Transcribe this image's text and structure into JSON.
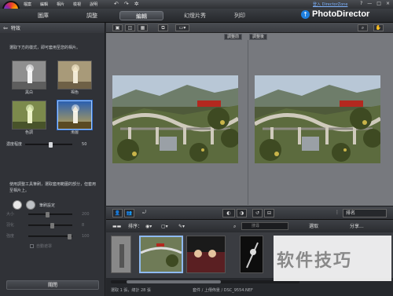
{
  "menubar": {
    "menus": [
      "檔案",
      "編輯",
      "相片",
      "檢視",
      "說明"
    ],
    "userzone_link": "登入 DirectorZone",
    "window_buttons": [
      "?",
      "—",
      "□",
      "×"
    ]
  },
  "modes": {
    "library": "圖庫",
    "adjust": "調整",
    "edit": "編輯",
    "slideshow": "幻燈片秀",
    "print": "列印"
  },
  "brand": {
    "name": "PhotoDirector"
  },
  "left_panel": {
    "title": "特效",
    "hint": "選取下方的樣式，即可套用至您的相片。",
    "effects": [
      {
        "label": "黑白",
        "selected": false
      },
      {
        "label": "褐色",
        "selected": false
      },
      {
        "label": "色調",
        "selected": false
      },
      {
        "label": "漸層",
        "selected": true
      }
    ],
    "strength": {
      "label": "濃度程度",
      "value": "50",
      "level": 0.5
    },
    "brush_desc": "使用調整工具筆刷，選取套用範圍的部分，但套用至相片上。",
    "brush_label": "筆刷設定",
    "brush_sliders": [
      {
        "label": "大小",
        "value": "200",
        "level": 0.4
      },
      {
        "label": "羽化",
        "value": "8",
        "level": 0.5
      },
      {
        "label": "強度",
        "value": "100",
        "level": 0.9
      }
    ],
    "checkbox_label": "自動遮罩",
    "close_button": "關閉"
  },
  "viewer": {
    "before_label": "調整前",
    "after_label": "調整後"
  },
  "strip": {
    "sort_label": "排序：",
    "search_placeholder": "搜尋",
    "select_button": "選取",
    "share_button": "分享...",
    "order_select": "排名"
  },
  "status": {
    "text": "選取 1 張，總計 28 張",
    "path": "套件 / 上傳佈景 / DSC_9554.NEF"
  },
  "watermark": {
    "text": "软件技巧"
  },
  "colors": {
    "accent": "#1e7fe0",
    "selection": "#8fbaf0",
    "panel_bg": "#303237",
    "viewer_bg": "#77797e"
  }
}
